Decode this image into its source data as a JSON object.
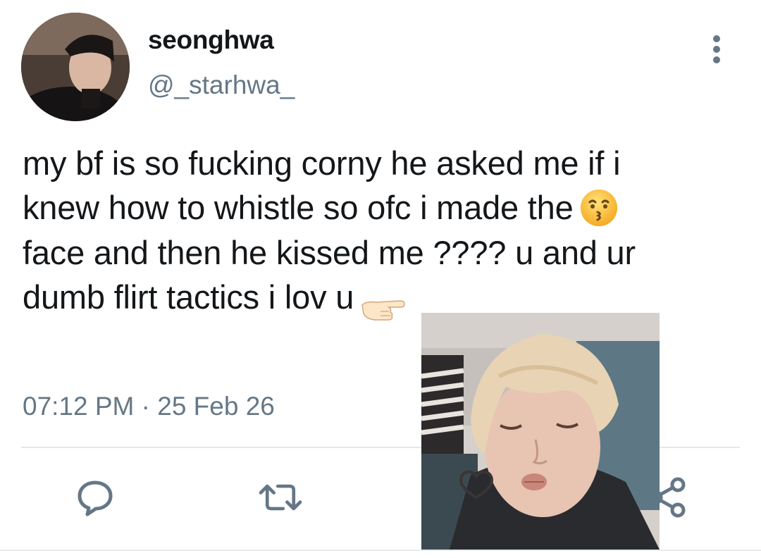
{
  "user": {
    "display_name": "seonghwa",
    "handle": "@_starhwa_"
  },
  "tweet": {
    "lines": [
      "my bf is so fucking corny he asked me if i",
      "knew how to whistle so ofc i made the",
      "face and then he kissed me ???? u and ur",
      "dumb flirt tactics i lov u"
    ],
    "emojis": [
      "kissing-face-emoji",
      "backhand-index-pointing-left-emoji"
    ],
    "timestamp": "07:12 PM · 25 Feb 26"
  },
  "actions": [
    "reply-icon",
    "retweet-icon",
    "like-icon",
    "share-icon"
  ],
  "colors": {
    "text": "#14171a",
    "muted": "#657786",
    "divider": "#e1e8ed"
  }
}
